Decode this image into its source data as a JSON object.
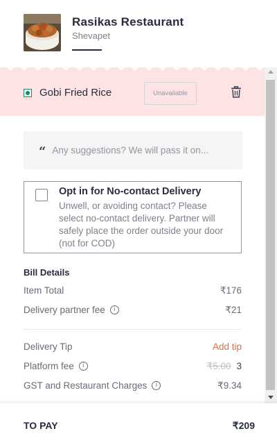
{
  "restaurant": {
    "name": "Rasikas Restaurant",
    "area": "Shevapet"
  },
  "cart_item": {
    "name": "Gobi Fried Rice",
    "status_label": "Unavailable",
    "veg": true
  },
  "suggestions": {
    "placeholder": "Any suggestions? We will pass it on..."
  },
  "no_contact": {
    "title": "Opt in for No-contact Delivery",
    "description": "Unwell, or avoiding contact? Please select no-contact delivery. Partner will safely place the order outside your door (not for COD)",
    "checked": false
  },
  "bill": {
    "title": "Bill Details",
    "item_total_label": "Item Total",
    "item_total_value": "₹176",
    "delivery_fee_label": "Delivery partner fee",
    "delivery_fee_value": "₹21",
    "tip_label": "Delivery Tip",
    "tip_action": "Add tip",
    "platform_fee_label": "Platform fee",
    "platform_fee_original": "₹5.00",
    "platform_fee_value": "3",
    "gst_label": "GST and Restaurant Charges",
    "gst_value": "₹9.34",
    "info_glyph": "i"
  },
  "to_pay": {
    "label": "TO PAY",
    "value": "₹209"
  },
  "colors": {
    "accent": "#e46d47",
    "veg_green": "#0f8a65",
    "unavailable_band": "#fde3e3"
  }
}
